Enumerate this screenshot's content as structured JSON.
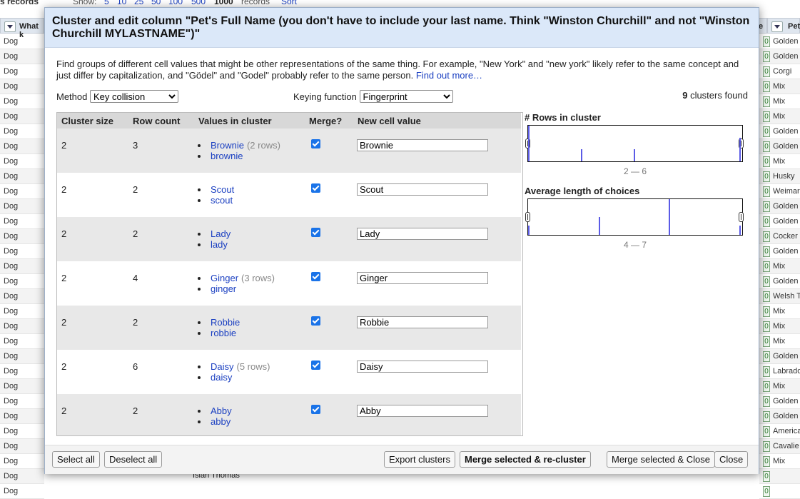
{
  "background": {
    "top_left": "s records",
    "show_label": "Show:",
    "page_sizes": [
      "5",
      "10",
      "25",
      "50",
      "100",
      "500",
      "1000"
    ],
    "records_label": "records",
    "sort_label": "Sort",
    "col_left_header": "What k",
    "col_right_header_a": "e",
    "col_right_header_b": "Pet",
    "left_cells": [
      "Dog",
      "Dog",
      "Dog",
      "Dog",
      "Dog",
      "Dog",
      "Dog",
      "Dog",
      "Dog",
      "Dog",
      "Dog",
      "Dog",
      "Dog",
      "Dog",
      "Dog",
      "Dog",
      "Dog",
      "Dog",
      "Dog",
      "Dog",
      "Dog",
      "Dog",
      "Dog",
      "Dog",
      "Dog",
      "Dog",
      "Dog",
      "Dog",
      "Dog",
      "Dog",
      "Dog"
    ],
    "right_counts": [
      "0",
      "0",
      "0",
      "0",
      "0",
      "0",
      "0",
      "0",
      "0",
      "0",
      "0",
      "0",
      "0",
      "0",
      "0",
      "0",
      "0",
      "0",
      "0",
      "0",
      "0",
      "0",
      "0",
      "0",
      "0",
      "0",
      "0",
      "0",
      "0",
      "0",
      "0"
    ],
    "right_cells": [
      "Golden",
      "Golden",
      "Corgi",
      "Mix",
      "Mix",
      "Mix",
      "Golden",
      "Golden",
      "Mix",
      "Husky",
      "Weimar",
      "Golden",
      "Golden",
      "Cocker",
      "Golden",
      "Mix",
      "Golden",
      "Welsh T",
      "Mix",
      "Mix",
      "Mix",
      "Golden",
      "Labrado",
      "Mix",
      "Golden",
      "Golden",
      "America",
      "Cavalie",
      "Mix",
      "",
      ""
    ],
    "bottom_text": "Isiah Thomas"
  },
  "dialog": {
    "title": "Cluster and edit column \"Pet's Full Name (you don't have to include your last name. Think \"Winston Churchill\" and not \"Winston Churchill MYLASTNAME\")\"",
    "description": "Find groups of different cell values that might be other representations of the same thing. For example, \"New York\" and \"new york\" likely refer to the same concept and just differ by capitalization, and \"Gödel\" and \"Godel\" probably refer to the same person.",
    "find_out_more": "Find out more…",
    "method_label": "Method",
    "method_value": "Key collision",
    "keying_label": "Keying function",
    "keying_value": "Fingerprint",
    "clusters_count": "9",
    "clusters_found_label": "clusters found",
    "table_headers": {
      "cluster_size": "Cluster size",
      "row_count": "Row count",
      "values": "Values in cluster",
      "merge": "Merge?",
      "new_value": "New cell value"
    },
    "clusters": [
      {
        "size": "2",
        "rows": "3",
        "values": [
          {
            "v": "Brownie",
            "rc": "(2 rows)"
          },
          {
            "v": "brownie",
            "rc": ""
          }
        ],
        "merge": true,
        "new_value": "Brownie"
      },
      {
        "size": "2",
        "rows": "2",
        "values": [
          {
            "v": "Scout",
            "rc": ""
          },
          {
            "v": "scout",
            "rc": ""
          }
        ],
        "merge": true,
        "new_value": "Scout"
      },
      {
        "size": "2",
        "rows": "2",
        "values": [
          {
            "v": "Lady",
            "rc": ""
          },
          {
            "v": "lady",
            "rc": ""
          }
        ],
        "merge": true,
        "new_value": "Lady"
      },
      {
        "size": "2",
        "rows": "4",
        "values": [
          {
            "v": "Ginger",
            "rc": "(3 rows)"
          },
          {
            "v": "ginger",
            "rc": ""
          }
        ],
        "merge": true,
        "new_value": "Ginger"
      },
      {
        "size": "2",
        "rows": "2",
        "values": [
          {
            "v": "Robbie",
            "rc": ""
          },
          {
            "v": "robbie",
            "rc": ""
          }
        ],
        "merge": true,
        "new_value": "Robbie"
      },
      {
        "size": "2",
        "rows": "6",
        "values": [
          {
            "v": "Daisy",
            "rc": "(5 rows)"
          },
          {
            "v": "daisy",
            "rc": ""
          }
        ],
        "merge": true,
        "new_value": "Daisy"
      },
      {
        "size": "2",
        "rows": "2",
        "values": [
          {
            "v": "Abby",
            "rc": ""
          },
          {
            "v": "abby",
            "rc": ""
          }
        ],
        "merge": true,
        "new_value": "Abby"
      }
    ],
    "facet_rows": {
      "title": "# Rows in cluster",
      "range": "2 — 6"
    },
    "facet_length": {
      "title": "Average length of choices",
      "range": "4 — 7"
    },
    "buttons": {
      "select_all": "Select all",
      "deselect_all": "Deselect all",
      "export": "Export clusters",
      "merge_recluster": "Merge selected & re-cluster",
      "merge_close": "Merge selected & Close",
      "close": "Close"
    },
    "colors": {
      "header_bg": "#dbe8f9",
      "link": "#1a3fc1",
      "histogram_bar": "#5b5be6",
      "checkbox": "#1a73e8"
    }
  },
  "chart_data": [
    {
      "type": "bar",
      "title": "# Rows in cluster",
      "x": [
        2,
        3,
        4,
        6
      ],
      "values": [
        3,
        1,
        1,
        2
      ],
      "xlim": [
        2,
        6
      ]
    },
    {
      "type": "bar",
      "title": "Average length of choices",
      "x": [
        4,
        5,
        6,
        7
      ],
      "values": [
        1,
        2,
        4,
        1
      ],
      "xlim": [
        4,
        7
      ]
    }
  ]
}
